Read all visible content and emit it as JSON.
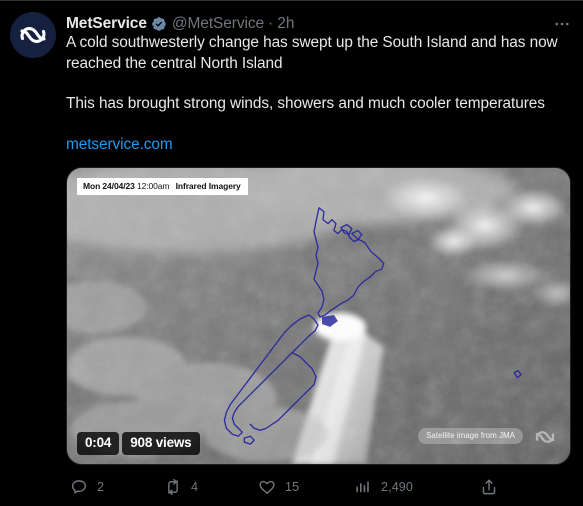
{
  "tweet": {
    "author": {
      "display_name": "MetService",
      "handle": "@MetService",
      "verified_badge": "verified-badge-icon",
      "avatar_icon": "metservice-swirl-logo"
    },
    "separator": "·",
    "timestamp": "2h",
    "overflow_menu": "more-options-icon",
    "text": {
      "paragraph_1": "A cold southwesterly change has swept up the South Island and has now reached the central North Island",
      "paragraph_2": "This has brought strong winds, showers and much cooler temperatures"
    },
    "link": {
      "label": "metservice.com",
      "color": "#1d9bf0"
    },
    "media": {
      "type": "video",
      "timestamp_badge": {
        "date": "Mon 24/04/23",
        "time": "12:00am",
        "imagery_type": "Infrared Imagery"
      },
      "duration": "0:04",
      "views_label": "908 views",
      "attribution": "Satellite image from JMA",
      "watermark_icon": "metservice-swirl-logo",
      "description": "Grayscale infrared satellite imagery of New Zealand with blue coastline outlines and a southwesterly frontal cloud band"
    },
    "actions": [
      {
        "name": "reply",
        "icon": "comment-icon",
        "count": "2"
      },
      {
        "name": "retweet",
        "icon": "retweet-icon",
        "count": "4"
      },
      {
        "name": "like",
        "icon": "heart-icon",
        "count": "15"
      },
      {
        "name": "views",
        "icon": "bar-chart-icon",
        "count": "2,490"
      },
      {
        "name": "share",
        "icon": "share-icon",
        "count": ""
      }
    ]
  },
  "theme": {
    "background": "#000000",
    "text": "#e7e9ea",
    "muted": "#71767b",
    "accent": "#1d9bf0",
    "border": "#2f3336",
    "avatar_bg": "#16213f"
  }
}
